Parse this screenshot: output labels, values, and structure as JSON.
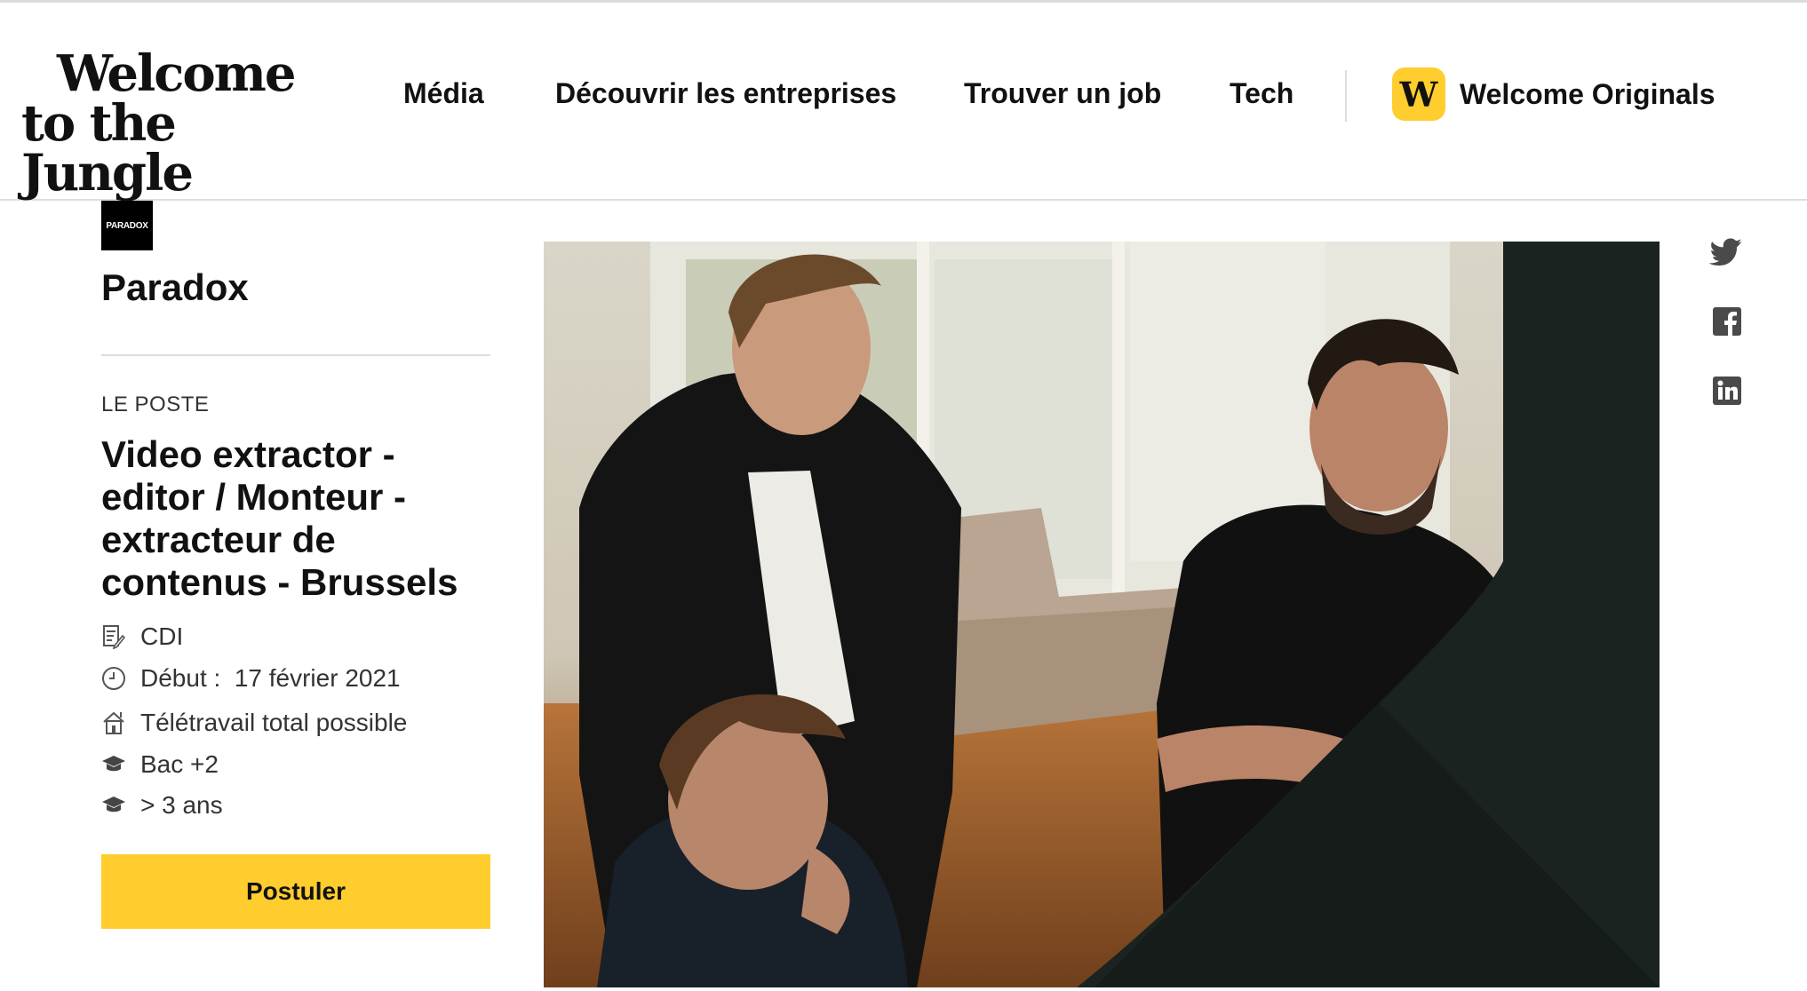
{
  "header": {
    "logo_line1": "Welcome",
    "logo_line2": "to the Jungle",
    "nav": {
      "media": "Média",
      "discover": "Découvrir les entreprises",
      "job": "Trouver un job",
      "tech": "Tech"
    },
    "originals_badge": "W",
    "originals_label": "Welcome Originals"
  },
  "company": {
    "logo_text": "PARADOX",
    "name": "Paradox"
  },
  "job": {
    "section_label": "LE POSTE",
    "title": "Video extractor - editor / Monteur - extracteur de contenus - Brussels",
    "facts": {
      "contract": "CDI",
      "start": "Début :  17 février 2021",
      "remote": "Télétravail total possible",
      "education": "Bac +2",
      "experience": "> 3 ans"
    },
    "apply_label": "Postuler"
  },
  "icons": {
    "contract": "contract-icon",
    "start": "clock-icon",
    "remote": "home-icon",
    "education": "graduation-cap-icon",
    "experience": "graduation-cap-icon",
    "twitter": "twitter-icon",
    "facebook": "facebook-icon",
    "linkedin": "linkedin-icon"
  },
  "colors": {
    "accent": "#ffcd2e",
    "text": "#111111",
    "muted": "#333333",
    "share_icon": "#4a4a4a"
  }
}
